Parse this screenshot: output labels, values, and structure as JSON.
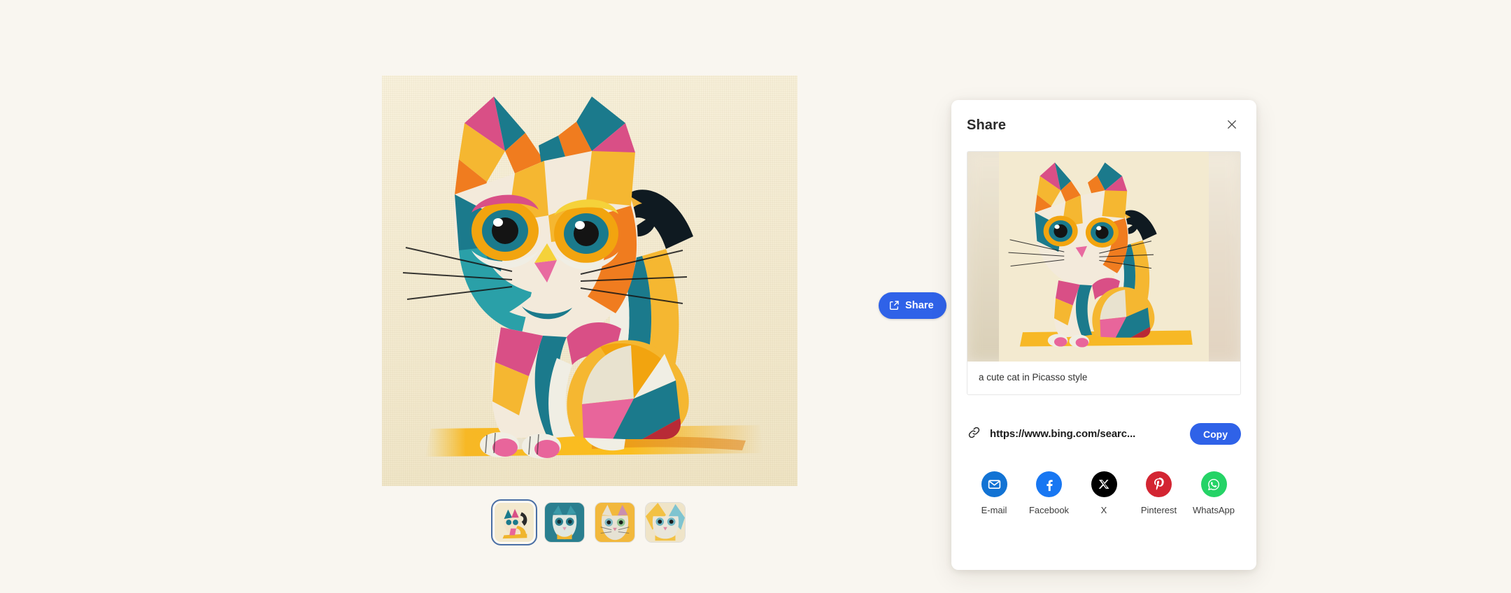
{
  "page": {
    "background_color": "#f9f6f0"
  },
  "viewer": {
    "name": "main-image",
    "alt": "a cute cat in Picasso style",
    "canvas_color": "#f6eed6"
  },
  "thumbnails": {
    "selected_index": 0,
    "items": [
      {
        "label": "cubist cat full body",
        "selected": true
      },
      {
        "label": "cubist cat portrait teal",
        "selected": false
      },
      {
        "label": "cubist cat portrait orange",
        "selected": false
      },
      {
        "label": "cubist cat portrait pastel",
        "selected": false
      }
    ]
  },
  "share_button": {
    "label": "Share",
    "icon": "share-icon",
    "color": "#2f62e8"
  },
  "share_panel": {
    "title": "Share",
    "close_icon": "close-icon",
    "preview": {
      "caption": "a cute cat in Picasso style"
    },
    "link": {
      "icon": "link-icon",
      "url": "https://www.bing.com/searc...",
      "copy_label": "Copy",
      "copy_color": "#2f62e8"
    },
    "socials": [
      {
        "label": "E-mail",
        "icon": "email-icon",
        "color": "#1273d4"
      },
      {
        "label": "Facebook",
        "icon": "facebook-icon",
        "color": "#1877f2"
      },
      {
        "label": "X",
        "icon": "x-icon",
        "color": "#000000"
      },
      {
        "label": "Pinterest",
        "icon": "pinterest-icon",
        "color": "#d32532"
      },
      {
        "label": "WhatsApp",
        "icon": "whatsapp-icon",
        "color": "#25d366"
      }
    ]
  }
}
